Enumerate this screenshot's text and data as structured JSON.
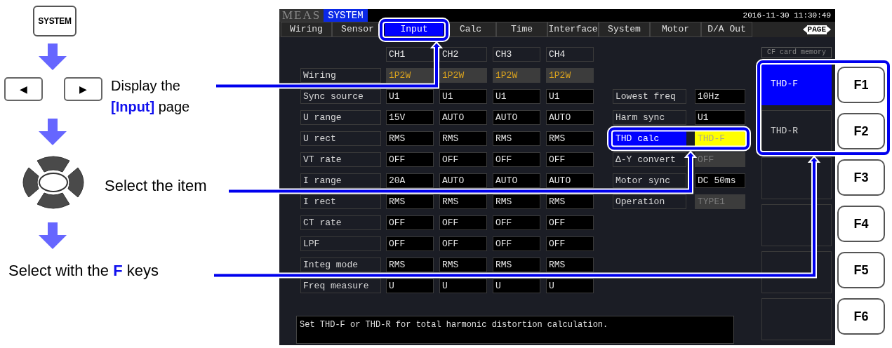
{
  "instructions": {
    "system_key": "SYSTEM",
    "arrow_keys": [
      "◀",
      "▶"
    ],
    "steps": [
      "Display the **[Input]** page",
      "Select the item",
      "Select with the **F** keys"
    ]
  },
  "screen": {
    "mode_tabs": [
      {
        "label": "MEAS",
        "selected": false
      },
      {
        "label": "SYSTEM",
        "selected": true
      }
    ],
    "datetime": "2016-11-30 11:30:49",
    "tabs": [
      {
        "label": "Wiring",
        "selected": false
      },
      {
        "label": "Sensor",
        "selected": false
      },
      {
        "label": "Input",
        "selected": true
      },
      {
        "label": "Calc",
        "selected": false
      },
      {
        "label": "Time",
        "selected": false
      },
      {
        "label": "Interface",
        "selected": false
      },
      {
        "label": "System",
        "selected": false
      },
      {
        "label": "Motor",
        "selected": false
      },
      {
        "label": "D/A Out",
        "selected": false
      }
    ],
    "page_indicator": "PAGE",
    "channels": [
      "CH1",
      "CH2",
      "CH3",
      "CH4"
    ],
    "rows": [
      {
        "label": "Wiring",
        "fixed": true,
        "values": [
          "1P2W",
          "1P2W",
          "1P2W",
          "1P2W"
        ]
      },
      {
        "label": "Sync source",
        "fixed": false,
        "values": [
          "U1",
          "U1",
          "U1",
          "U1"
        ]
      },
      {
        "label": "U range",
        "fixed": false,
        "values": [
          "15V",
          "AUTO",
          "AUTO",
          "AUTO"
        ]
      },
      {
        "label": "U rect",
        "fixed": false,
        "values": [
          "RMS",
          "RMS",
          "RMS",
          "RMS"
        ]
      },
      {
        "label": "VT rate",
        "fixed": false,
        "values": [
          "OFF",
          "OFF",
          "OFF",
          "OFF"
        ]
      },
      {
        "label": "I range",
        "fixed": false,
        "values": [
          "20A",
          "AUTO",
          "AUTO",
          "AUTO"
        ]
      },
      {
        "label": "I rect",
        "fixed": false,
        "values": [
          "RMS",
          "RMS",
          "RMS",
          "RMS"
        ]
      },
      {
        "label": "CT rate",
        "fixed": false,
        "values": [
          "OFF",
          "OFF",
          "OFF",
          "OFF"
        ]
      },
      {
        "label": "LPF",
        "fixed": false,
        "values": [
          "OFF",
          "OFF",
          "OFF",
          "OFF"
        ]
      },
      {
        "label": "Integ mode",
        "fixed": false,
        "values": [
          "RMS",
          "RMS",
          "RMS",
          "RMS"
        ]
      },
      {
        "label": "Freq measure",
        "fixed": false,
        "values": [
          "U",
          "U",
          "U",
          "U"
        ]
      }
    ],
    "settings": [
      {
        "label": "Lowest freq",
        "selected": false,
        "value": "10Hz",
        "disabled": false
      },
      {
        "label": "Harm sync",
        "selected": false,
        "value": "U1",
        "disabled": false
      },
      {
        "label": "THD calc",
        "selected": true,
        "value": "THD-F",
        "disabled": false
      },
      {
        "label": "Δ-Y convert",
        "selected": false,
        "value": "OFF",
        "disabled": true
      },
      {
        "label": "Motor sync",
        "selected": false,
        "value": "DC 50ms",
        "disabled": false
      },
      {
        "label": "Operation",
        "selected": false,
        "value": "TYPE1",
        "disabled": true
      }
    ],
    "menu": {
      "title": "CF card memory",
      "slots": [
        {
          "label": "THD-F",
          "selected": true
        },
        {
          "label": "THD-R",
          "selected": false
        },
        {
          "selected": false
        },
        {
          "selected": false
        },
        {
          "selected": false
        },
        {
          "selected": false
        }
      ]
    },
    "message": "Set THD-F or THD-R for total harmonic distortion calculation."
  },
  "function_keys": [
    "F1",
    "F2",
    "F3",
    "F4",
    "F5",
    "F6"
  ]
}
